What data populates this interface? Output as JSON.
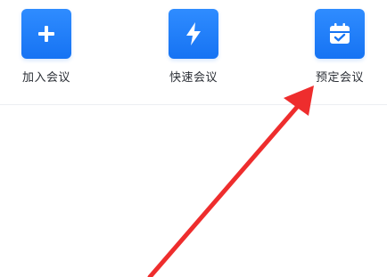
{
  "actions": [
    {
      "label": "加入会议",
      "icon": "plus-icon"
    },
    {
      "label": "快速会议",
      "icon": "lightning-icon"
    },
    {
      "label": "预定会议",
      "icon": "calendar-check-icon"
    }
  ],
  "colors": {
    "tile": "#1673f3",
    "label_text": "#2b2f36",
    "annotation_arrow": "#ee2d2d"
  }
}
